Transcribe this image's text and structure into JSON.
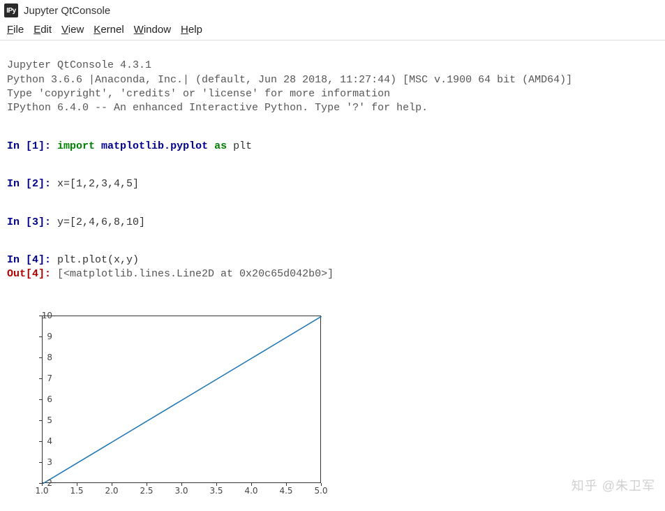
{
  "window": {
    "logo_text": "IPy",
    "title": "Jupyter QtConsole"
  },
  "menubar": {
    "items": [
      {
        "mnemonic": "F",
        "rest": "ile"
      },
      {
        "mnemonic": "E",
        "rest": "dit"
      },
      {
        "mnemonic": "V",
        "rest": "iew"
      },
      {
        "mnemonic": "K",
        "rest": "ernel"
      },
      {
        "mnemonic": "W",
        "rest": "indow"
      },
      {
        "mnemonic": "H",
        "rest": "elp"
      }
    ]
  },
  "banner": {
    "line1": "Jupyter QtConsole 4.3.1",
    "line2": "Python 3.6.6 |Anaconda, Inc.| (default, Jun 28 2018, 11:27:44) [MSC v.1900 64 bit (AMD64)]",
    "line3": "Type 'copyright', 'credits' or 'license' for more information",
    "line4": "IPython 6.4.0 -- An enhanced Interactive Python. Type '?' for help."
  },
  "cells": {
    "c1": {
      "prompt": "In [1]: ",
      "kw_import": "import",
      "module": "matplotlib.pyplot",
      "kw_as": "as",
      "alias": "plt"
    },
    "c2": {
      "prompt": "In [2]: ",
      "code": "x=[1,2,3,4,5]"
    },
    "c3": {
      "prompt": "In [3]: ",
      "code": "y=[2,4,6,8,10]"
    },
    "c4": {
      "prompt": "In [4]: ",
      "code": "plt.plot(x,y)",
      "out_prompt": "Out[4]: ",
      "out_value": "[<matplotlib.lines.Line2D at 0x20c65d042b0>]"
    }
  },
  "chart_data": {
    "type": "line",
    "x": [
      1,
      2,
      3,
      4,
      5
    ],
    "y": [
      2,
      4,
      6,
      8,
      10
    ],
    "xlim": [
      1.0,
      5.0
    ],
    "ylim": [
      2,
      10
    ],
    "xticks": [
      "1.0",
      "1.5",
      "2.0",
      "2.5",
      "3.0",
      "3.5",
      "4.0",
      "4.5",
      "5.0"
    ],
    "yticks": [
      "2",
      "3",
      "4",
      "5",
      "6",
      "7",
      "8",
      "9",
      "10"
    ],
    "line_color": "#1f77b4"
  },
  "watermark": "知乎 @朱卫军"
}
